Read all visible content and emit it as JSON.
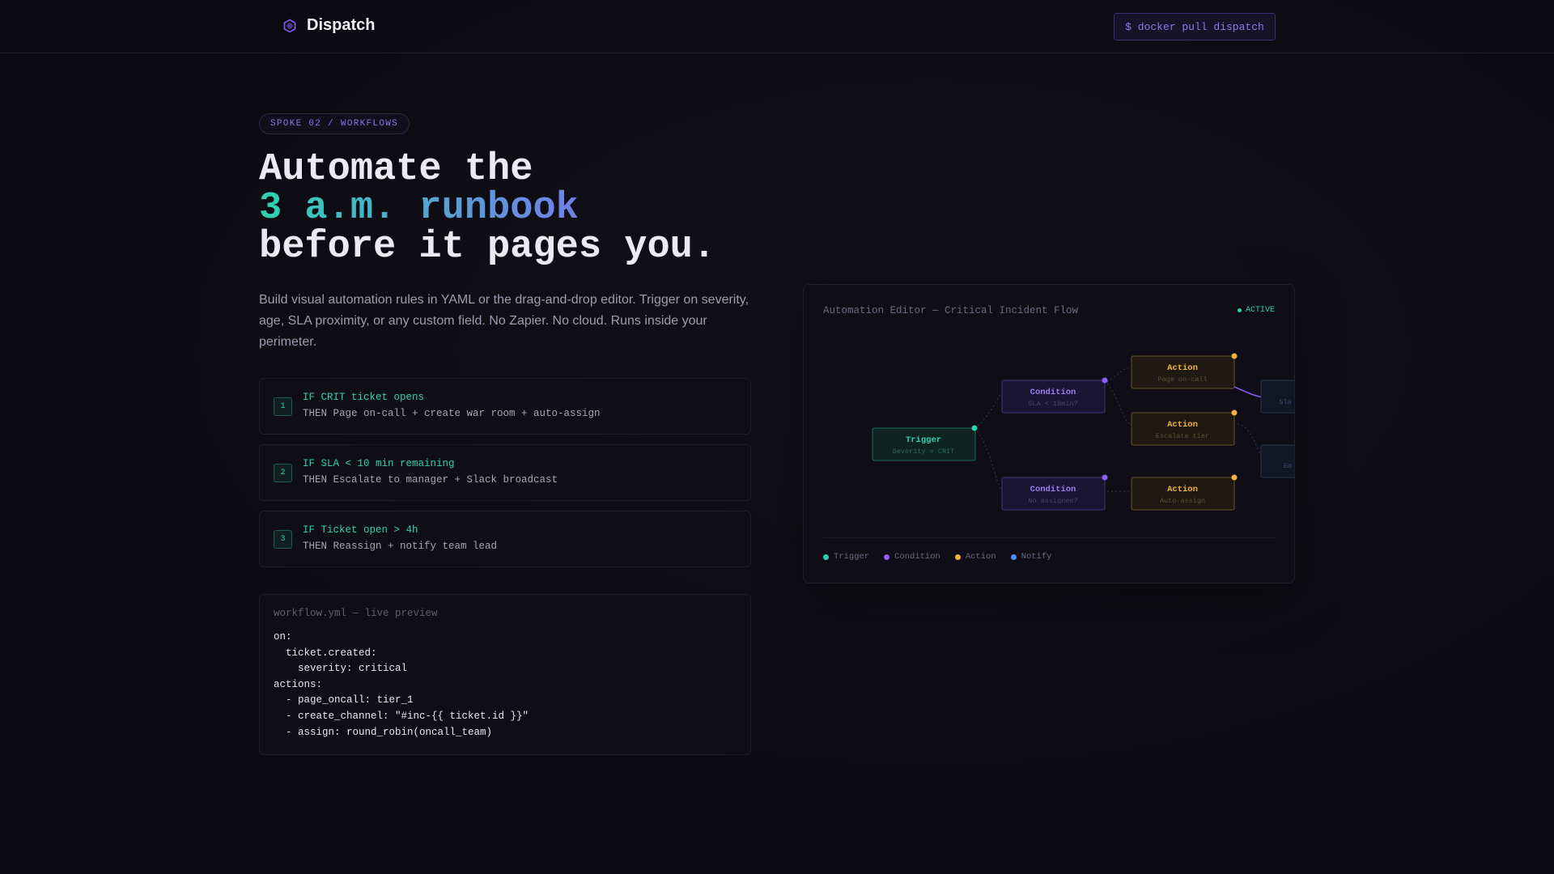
{
  "nav": {
    "brand": "Dispatch",
    "cta": "$ docker pull dispatch"
  },
  "hero": {
    "tag": "SPOKE 02 / WORKFLOWS",
    "line1": "Automate the",
    "line2": "3 a.m. runbook",
    "line3": "before it pages you.",
    "lede": "Build visual automation rules in YAML or the drag-and-drop editor. Trigger on severity, age, SLA proximity, or any custom field. No Zapier. No cloud. Runs inside your perimeter."
  },
  "rules": [
    {
      "num": "1",
      "if": "IF CRIT ticket opens",
      "then": "THEN Page on-call + create war room + auto-assign"
    },
    {
      "num": "2",
      "if": "IF SLA < 10 min remaining",
      "then": "THEN Escalate to manager + Slack broadcast"
    },
    {
      "num": "3",
      "if": "IF Ticket open > 4h",
      "then": "THEN Reassign + notify team lead"
    }
  ],
  "code": {
    "title": "workflow.yml — live preview",
    "body": "on:\n  ticket.created:\n    severity: critical\nactions:\n  - page_oncall: tier_1\n  - create_channel: \"#inc-{{ ticket.id }}\"\n  - assign: round_robin(oncall_team)"
  },
  "editor": {
    "title": "Automation Editor — Critical Incident Flow",
    "status": "ACTIVE",
    "nodes": {
      "trigger": {
        "label": "Trigger",
        "sub": "Severity = CRIT"
      },
      "condition1": {
        "label": "Condition",
        "sub": "SLA < 10min?"
      },
      "condition2": {
        "label": "Condition",
        "sub": "No assignee?"
      },
      "action1": {
        "label": "Action",
        "sub": "Page on-call"
      },
      "action2": {
        "label": "Action",
        "sub": "Escalate tier"
      },
      "action3": {
        "label": "Action",
        "sub": "Auto-assign"
      },
      "notify1": {
        "sub": "Sla"
      },
      "notify2": {
        "sub": "Em"
      }
    },
    "legend": [
      {
        "label": "Trigger",
        "color": "#2fd1b0"
      },
      {
        "label": "Condition",
        "color": "#8b5cf6"
      },
      {
        "label": "Action",
        "color": "#f5b13d"
      },
      {
        "label": "Notify",
        "color": "#4f8ff7"
      }
    ]
  },
  "colors": {
    "trigger": "#2fd1b0",
    "condition": "#8b5cf6",
    "action": "#f5b13d",
    "notify": "#4f8ff7"
  }
}
